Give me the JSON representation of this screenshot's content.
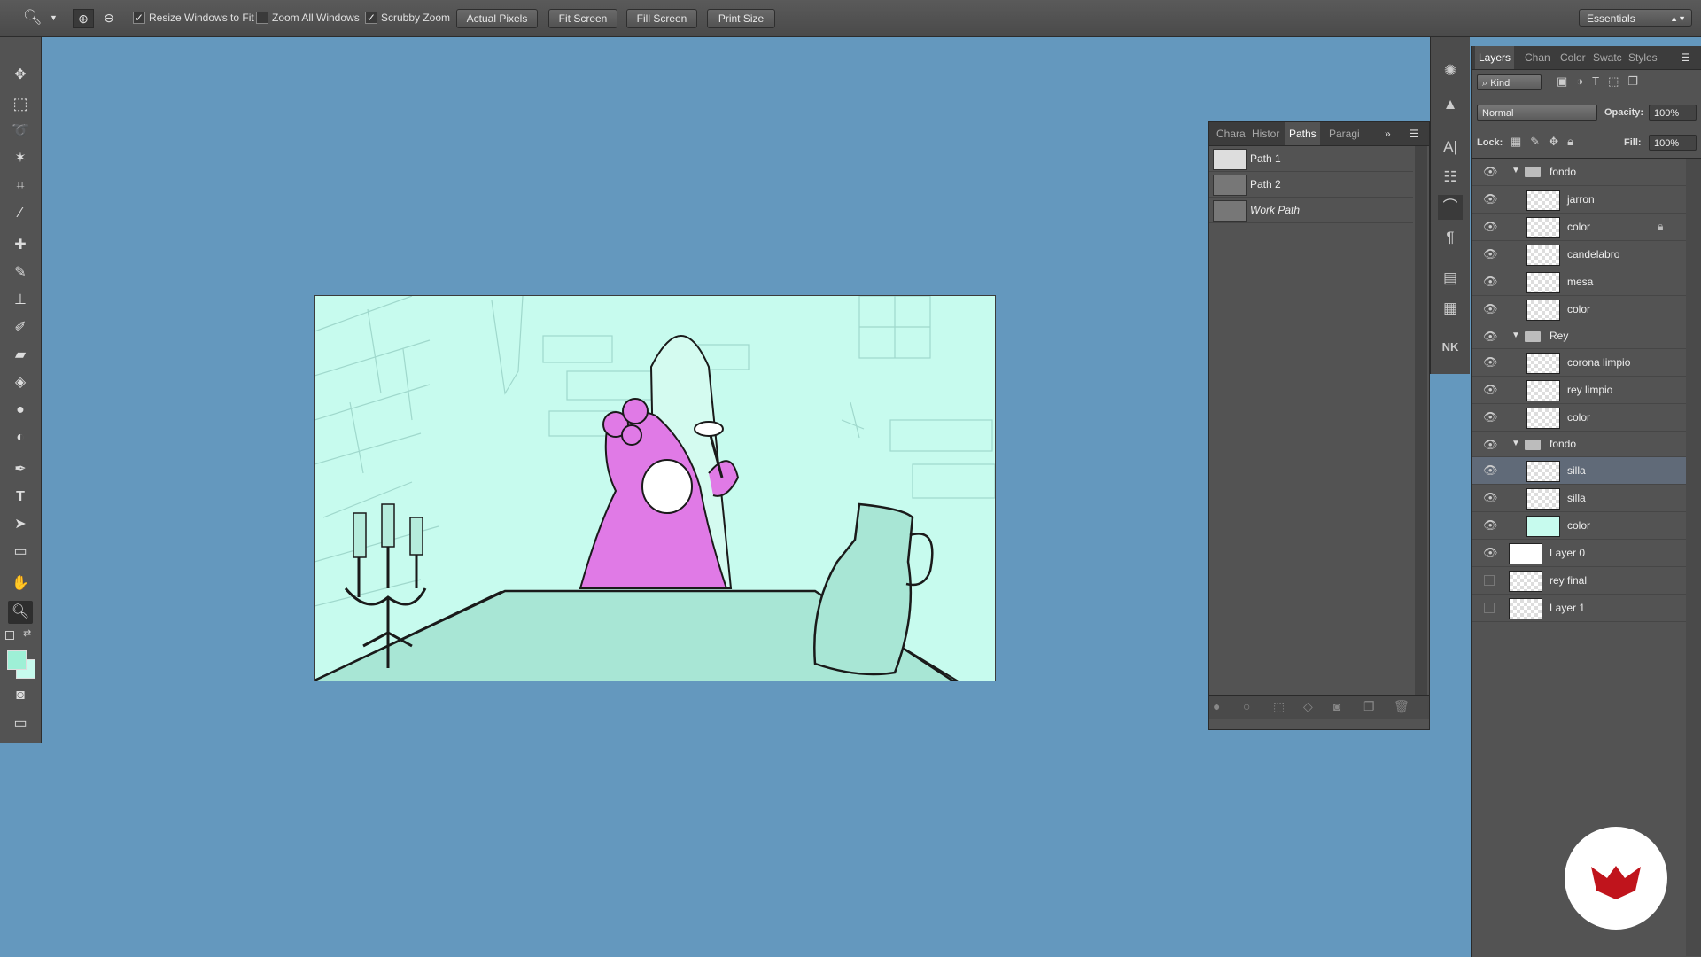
{
  "options_bar": {
    "resize_windows": "Resize Windows to Fit",
    "zoom_all": "Zoom All Windows",
    "scrubby_zoom": "Scrubby Zoom",
    "actual_pixels": "Actual Pixels",
    "fit_screen": "Fit Screen",
    "fill_screen": "Fill Screen",
    "print_size": "Print Size",
    "workspace": "Essentials"
  },
  "paths_panel": {
    "tabs": [
      "Chara",
      "Histor",
      "Paths",
      "Paragi"
    ],
    "active_tab": "Paths",
    "paths": [
      {
        "name": "Path 1"
      },
      {
        "name": "Path 2"
      },
      {
        "name": "Work Path"
      }
    ]
  },
  "layers_panel": {
    "tabs": [
      "Layers",
      "Chan",
      "Color",
      "Swatc",
      "Styles"
    ],
    "filter": "Kind",
    "blend_mode": "Normal",
    "opacity_label": "Opacity:",
    "opacity_value": "100%",
    "lock_label": "Lock:",
    "fill_label": "Fill:",
    "fill_value": "100%",
    "layers": [
      {
        "name": "fondo",
        "type": "group"
      },
      {
        "name": "jarron",
        "type": "layer"
      },
      {
        "name": "color",
        "type": "layer",
        "locked": true
      },
      {
        "name": "candelabro",
        "type": "layer"
      },
      {
        "name": "mesa",
        "type": "layer"
      },
      {
        "name": "color",
        "type": "layer"
      },
      {
        "name": "Rey",
        "type": "group"
      },
      {
        "name": "corona limpio",
        "type": "layer"
      },
      {
        "name": "rey limpio",
        "type": "layer"
      },
      {
        "name": "color",
        "type": "layer"
      },
      {
        "name": "fondo",
        "type": "group"
      },
      {
        "name": "silla",
        "type": "layer",
        "selected": true
      },
      {
        "name": "silla",
        "type": "layer"
      },
      {
        "name": "color",
        "type": "layer"
      },
      {
        "name": "Layer 0",
        "type": "layer"
      },
      {
        "name": "rey final",
        "type": "layer"
      },
      {
        "name": "Layer 1",
        "type": "layer"
      }
    ]
  },
  "colors": {
    "canvas_bg": "#6498be",
    "panel_bg": "#535353",
    "doc_bg": "#c7fbee",
    "king_color": "#e07ae6",
    "logo_red": "#c0141c"
  }
}
